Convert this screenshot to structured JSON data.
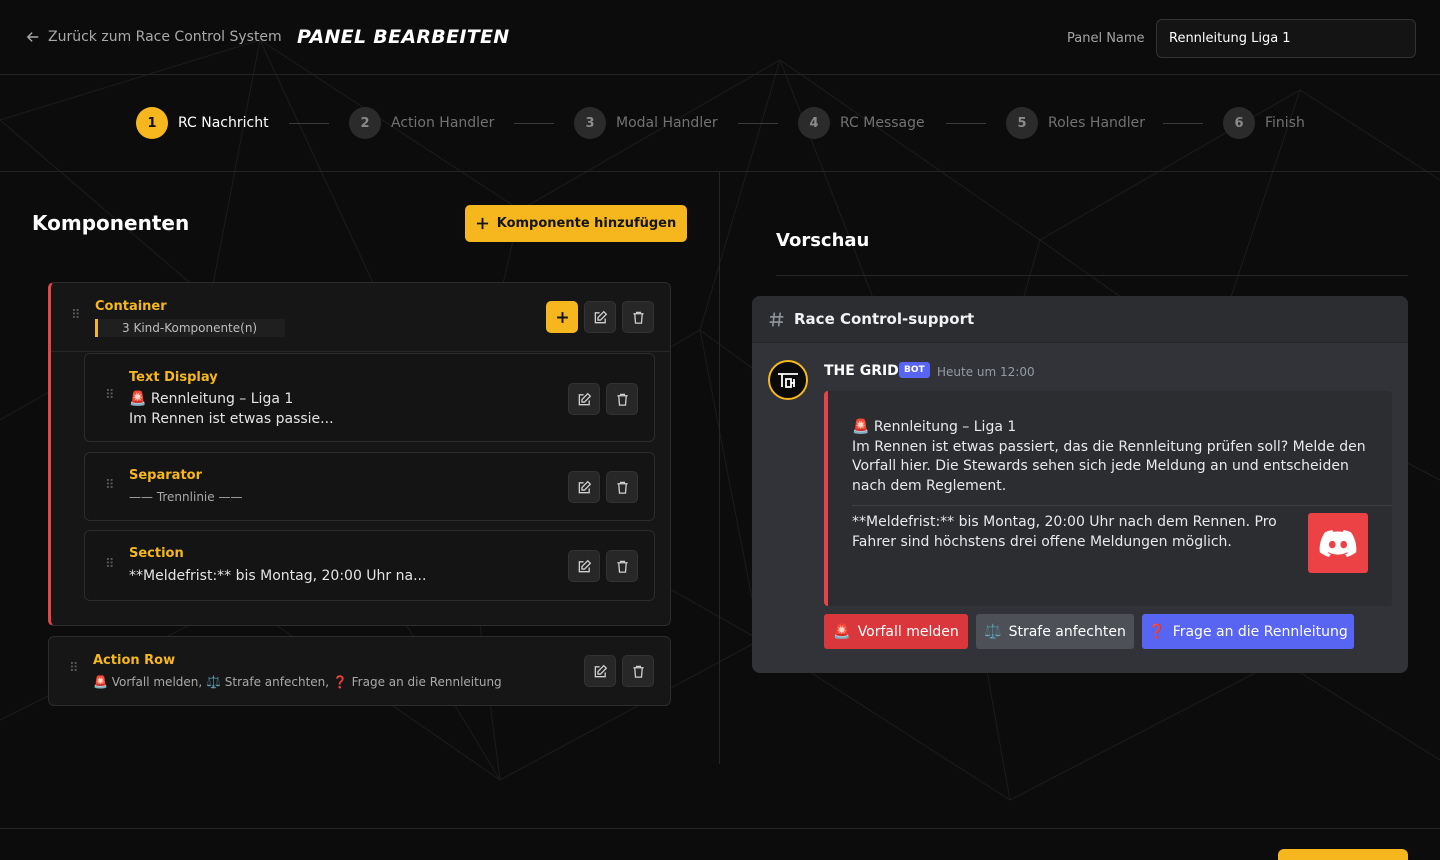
{
  "header": {
    "back_label": "Zurück zum Race Control System",
    "title": "PANEL BEARBEITEN",
    "panel_name_label": "Panel Name",
    "panel_name_value": "Rennleitung Liga 1"
  },
  "steps": [
    {
      "num": "1",
      "label": "RC Nachricht",
      "active": true
    },
    {
      "num": "2",
      "label": "Action Handler",
      "active": false
    },
    {
      "num": "3",
      "label": "Modal Handler",
      "active": false
    },
    {
      "num": "4",
      "label": "RC Message",
      "active": false
    },
    {
      "num": "5",
      "label": "Roles Handler",
      "active": false
    },
    {
      "num": "6",
      "label": "Finish",
      "active": false
    }
  ],
  "components": {
    "title": "Komponenten",
    "add_button": "Komponente hinzufügen",
    "container": {
      "name": "Container",
      "children_count": "3 Kind-Komponente(n)"
    },
    "text_display": {
      "name": "Text Display",
      "line1": "🚨 Rennleitung – Liga 1",
      "line2": "Im Rennen ist etwas passie..."
    },
    "separator": {
      "name": "Separator",
      "line": "—— Trennlinie ——"
    },
    "section": {
      "name": "Section",
      "line": "**Meldefrist:** bis Montag, 20:00 Uhr na..."
    },
    "action_row": {
      "name": "Action Row",
      "line": "🚨 Vorfall melden, ⚖️ Strafe anfechten, ❓ Frage an die Rennleitung"
    }
  },
  "preview": {
    "title": "Vorschau",
    "channel": "Race Control-support",
    "bot_name": "THE GRID",
    "bot_tag": "BOT",
    "timestamp": "Heute um 12:00",
    "embed_title": "🚨 Rennleitung – Liga 1",
    "embed_body_1": "Im Rennen ist etwas passiert, das die Rennleitung prüfen soll? Melde den",
    "embed_body_2": "Vorfall hier. Die Stewards sehen sich jede Meldung an und entscheiden",
    "embed_body_3": "nach dem Reglement.",
    "section_text_1": "**Meldefrist:** bis Montag, 20:00 Uhr nach dem Rennen. Pro",
    "section_text_2": "Fahrer sind höchstens drei offene Meldungen möglich.",
    "buttons": [
      {
        "icon": "🚨",
        "label": "Vorfall melden"
      },
      {
        "icon": "⚖️",
        "label": "Strafe anfechten"
      },
      {
        "icon": "❓",
        "label": "Frage an die Rennleitung"
      }
    ]
  },
  "colors": {
    "accent": "#f5b71d",
    "danger": "#e6434a",
    "discord_blurple": "#5865f2",
    "discord_bg": "#313338"
  }
}
